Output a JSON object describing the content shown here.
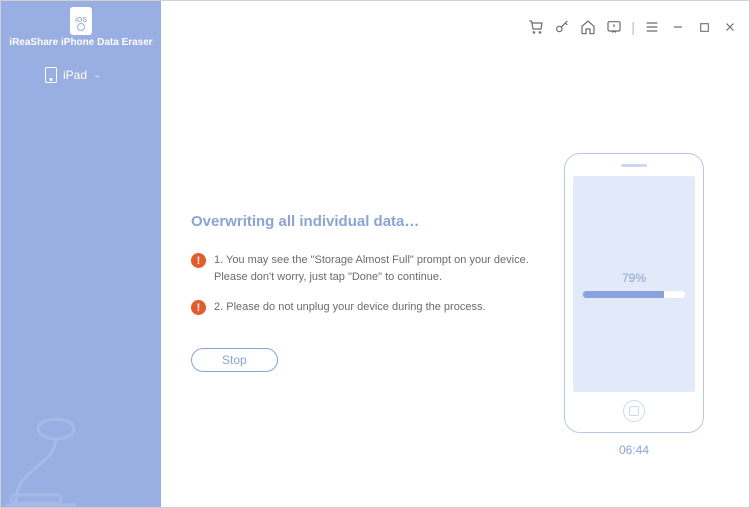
{
  "app": {
    "title": "iReaShare iPhone Data Eraser",
    "logo_badge": "iOS"
  },
  "sidebar": {
    "device_label": "iPad"
  },
  "main": {
    "heading": "Overwriting all individual data…",
    "warnings": [
      "1. You may see the \"Storage Almost Full\" prompt on your device. Please don't worry, just tap \"Done\" to continue.",
      "2. Please do not unplug your device during the process."
    ],
    "stop_label": "Stop"
  },
  "progress": {
    "percent_label": "79%",
    "percent_value": 79,
    "elapsed": "06:44"
  },
  "colors": {
    "accent": "#99aee3",
    "warn": "#e85a2a"
  }
}
